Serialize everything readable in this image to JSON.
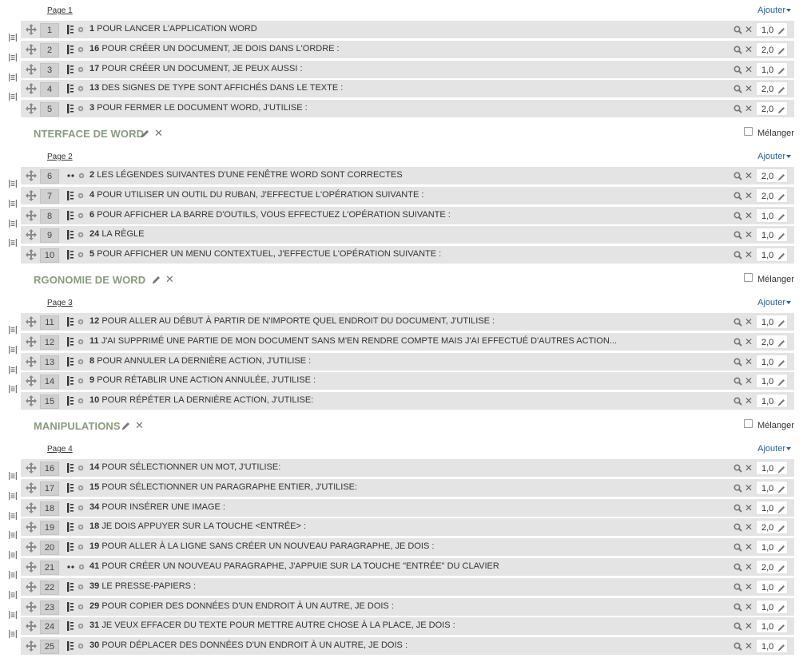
{
  "add_label": "Ajouter",
  "shuffle_label": "Mélanger",
  "pages": [
    {
      "label": "Page 1",
      "rows": [
        {
          "num": "1",
          "qnum": "1",
          "text": "POUR LANCER L'APPLICATION WORD",
          "grade": "1,0",
          "icon": "multichoice-icon"
        },
        {
          "num": "2",
          "qnum": "16",
          "text": "POUR CRÉER UN DOCUMENT, JE DOIS DANS L'ORDRE :",
          "grade": "2,0",
          "icon": "multichoice-icon"
        },
        {
          "num": "3",
          "qnum": "17",
          "text": "POUR CRÉER UN DOCUMENT, JE PEUX AUSSI :",
          "grade": "1,0",
          "icon": "multichoice-icon"
        },
        {
          "num": "4",
          "qnum": "13",
          "text": "DES SIGNES DE TYPE SONT AFFICHÉS DANS LE TEXTE :",
          "grade": "2,0",
          "icon": "multichoice-icon"
        },
        {
          "num": "5",
          "qnum": "3",
          "text": "POUR FERMER LE DOCUMENT WORD, J'UTILISE :",
          "grade": "2,0",
          "icon": "multichoice-icon"
        }
      ]
    },
    {
      "section": "NTERFACE DE WORD",
      "label": "Page 2",
      "rows": [
        {
          "num": "6",
          "qnum": "2",
          "text": "LES LÉGENDES SUIVANTES D'UNE FENÊTRE WORD SONT CORRECTES",
          "grade": "2,0",
          "icon": "match-icon"
        },
        {
          "num": "7",
          "qnum": "4",
          "text": "POUR UTILISER UN OUTIL DU RUBAN, J'EFFECTUE L'OPÉRATION SUIVANTE :",
          "grade": "2,0",
          "icon": "multichoice-icon"
        },
        {
          "num": "8",
          "qnum": "6",
          "text": "POUR AFFICHER LA BARRE D'OUTILS, VOUS EFFECTUEZ L'OPÉRATION SUIVANTE :",
          "grade": "1,0",
          "icon": "multichoice-icon"
        },
        {
          "num": "9",
          "qnum": "24",
          "text": "LA RÈGLE",
          "grade": "1,0",
          "icon": "multichoice-icon"
        },
        {
          "num": "10",
          "qnum": "5",
          "text": "POUR AFFICHER UN MENU CONTEXTUEL, J'EFFECTUE L'OPÉRATION SUIVANTE :",
          "grade": "1,0",
          "icon": "multichoice-icon"
        }
      ]
    },
    {
      "section": "RGONOMIE DE WORD",
      "label": "Page 3",
      "rows": [
        {
          "num": "11",
          "qnum": "12",
          "text": "POUR ALLER AU DÉBUT À PARTIR DE N'IMPORTE QUEL ENDROIT DU DOCUMENT, J'UTILISE :",
          "grade": "1,0",
          "icon": "multichoice-icon"
        },
        {
          "num": "12",
          "qnum": "11",
          "text": "J'AI SUPPRIMÉ UNE PARTIE DE MON DOCUMENT SANS M'EN RENDRE COMPTE MAIS J'AI EFFECTUÉ D'AUTRES ACTION...",
          "grade": "2,0",
          "icon": "multichoice-icon"
        },
        {
          "num": "13",
          "qnum": "8",
          "text": "POUR ANNULER LA DERNIÈRE ACTION, J'UTILISE :",
          "grade": "1,0",
          "icon": "multichoice-icon"
        },
        {
          "num": "14",
          "qnum": "9",
          "text": "POUR RÉTABLIR UNE ACTION ANNULÉE, J'UTILISE :",
          "grade": "1,0",
          "icon": "multichoice-icon"
        },
        {
          "num": "15",
          "qnum": "10",
          "text": "POUR RÉPÉTER LA DERNIÈRE ACTION, J'UTILISE:",
          "grade": "1,0",
          "icon": "multichoice-icon"
        }
      ]
    },
    {
      "section": "MANIPULATIONS",
      "label": "Page 4",
      "rows": [
        {
          "num": "16",
          "qnum": "14",
          "text": "POUR SÉLECTIONNER UN MOT, J'UTILISE:",
          "grade": "1,0",
          "icon": "multichoice-icon"
        },
        {
          "num": "17",
          "qnum": "15",
          "text": "POUR SÉLECTIONNER UN PARAGRAPHE ENTIER, J'UTILISE:",
          "grade": "1,0",
          "icon": "multichoice-icon"
        },
        {
          "num": "18",
          "qnum": "34",
          "text": "POUR INSÉRER UNE IMAGE :",
          "grade": "1,0",
          "icon": "multichoice-icon"
        },
        {
          "num": "19",
          "qnum": "18",
          "text": "JE DOIS APPUYER SUR LA TOUCHE <ENTRÉE> :",
          "grade": "2,0",
          "icon": "multichoice-icon"
        },
        {
          "num": "20",
          "qnum": "19",
          "text": "POUR ALLER À LA LIGNE SANS CRÉER UN NOUVEAU PARAGRAPHE, JE DOIS :",
          "grade": "1,0",
          "icon": "multichoice-icon"
        },
        {
          "num": "21",
          "qnum": "41",
          "text": "POUR CRÉER UN NOUVEAU PARAGRAPHE, J'APPUIE SUR LA TOUCHE \"ENTRÉE\" DU CLAVIER",
          "grade": "2,0",
          "icon": "match-icon"
        },
        {
          "num": "22",
          "qnum": "39",
          "text": "LE PRESSE-PAPIERS :",
          "grade": "1,0",
          "icon": "multichoice-icon"
        },
        {
          "num": "23",
          "qnum": "29",
          "text": "POUR COPIER DES DONNÉES D'UN ENDROIT À UN AUTRE, JE DOIS :",
          "grade": "1,0",
          "icon": "multichoice-icon"
        },
        {
          "num": "24",
          "qnum": "31",
          "text": "JE VEUX EFFACER DU TEXTE POUR METTRE AUTRE CHOSE À LA PLACE, JE DOIS :",
          "grade": "1,0",
          "icon": "multichoice-icon"
        },
        {
          "num": "25",
          "qnum": "30",
          "text": "POUR DÉPLACER DES DONNÉES D'UN ENDROIT À UN AUTRE, JE DOIS :",
          "grade": "1,0",
          "icon": "multichoice-icon"
        }
      ]
    }
  ]
}
